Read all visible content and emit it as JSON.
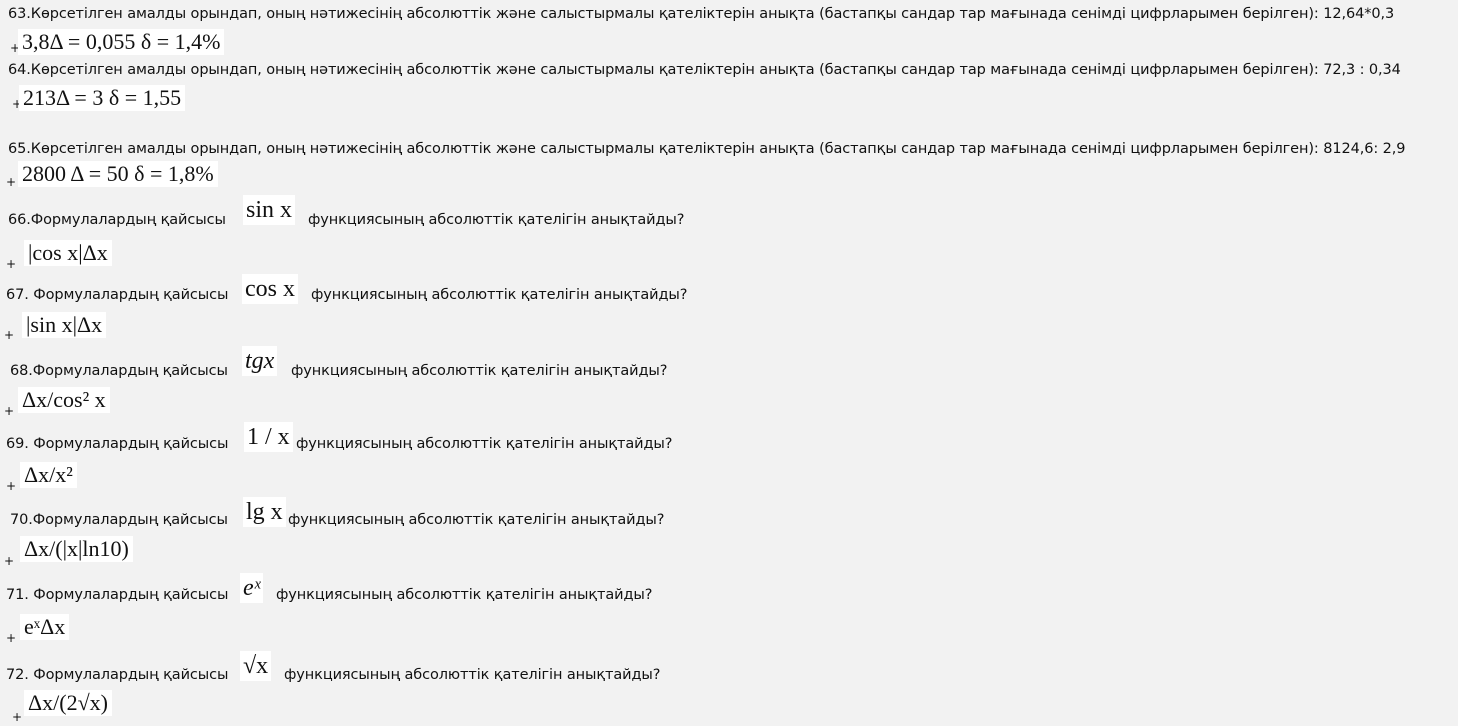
{
  "items": [
    {
      "q": "63.Көрсетілген амалды орындап, оның нәтижесінің абсолюттік және салыстырмалы қателіктерін анықта (бастапқы сандар тар мағынада сенімді цифрларымен берілген): 12,64*0,3",
      "plus": "+",
      "answer": "3,8Δ = 0,055 δ = 1,4%"
    },
    {
      "q": "64.Көрсетілген амалды орындап, оның нәтижесінің абсолюттік және салыстырмалы қателіктерін анықта (бастапқы сандар тар мағынада сенімді цифрларымен берілген): 72,3 : 0,34",
      "plus": "+",
      "answer": "213Δ = 3 δ = 1,55"
    },
    {
      "q": "65.Көрсетілген амалды орындап, оның нәтижесінің абсолюттік және салыстырмалы қателіктерін анықта (бастапқы сандар тар мағынада сенімді цифрларымен берілген): 8124,6: 2,9",
      "plus": "+",
      "answer": "2800 Δ = 50 δ = 1,8%"
    },
    {
      "q_pre": "66.Формулалардың қайсысы",
      "formula": "sin x",
      "q_post": "функциясының абсолюттік қателігін анықтайды?",
      "plus": "+",
      "answer": "|cos x|Δx"
    },
    {
      "q_pre": "67. Формулалардың қайсысы",
      "formula": "cos x",
      "q_post": "функциясының абсолюттік қателігін анықтайды?",
      "plus": "+",
      "answer": "|sin x|Δx"
    },
    {
      "q_pre": "68.Формулалардың қайсысы",
      "formula": "tgx",
      "q_post": "функциясының абсолюттік қателігін анықтайды?",
      "plus": "+",
      "answer": "Δx/cos² x"
    },
    {
      "q_pre": "69. Формулалардың қайсысы",
      "formula": "1 / x",
      "q_post": "функциясының абсолюттік қателігін анықтайды?",
      "plus": "+",
      "answer": "Δx/x²"
    },
    {
      "q_pre": "70.Формулалардың қайсысы",
      "formula": "lg x",
      "q_post": "функциясының абсолюттік қателігін анықтайды?",
      "plus": "+",
      "answer": "Δx/(|x|ln10)"
    },
    {
      "q_pre": "71. Формулалардың қайсысы",
      "formula": "eˣ",
      "q_post": "функциясының абсолюттік қателігін анықтайды?",
      "plus": "+",
      "answer": "eˣΔx"
    },
    {
      "q_pre": "72. Формулалардың қайсысы",
      "formula": "√x",
      "q_post": "функциясының абсолюттік қателігін анықтайды?",
      "plus": "+",
      "answer": "Δx/(2√x)"
    }
  ]
}
